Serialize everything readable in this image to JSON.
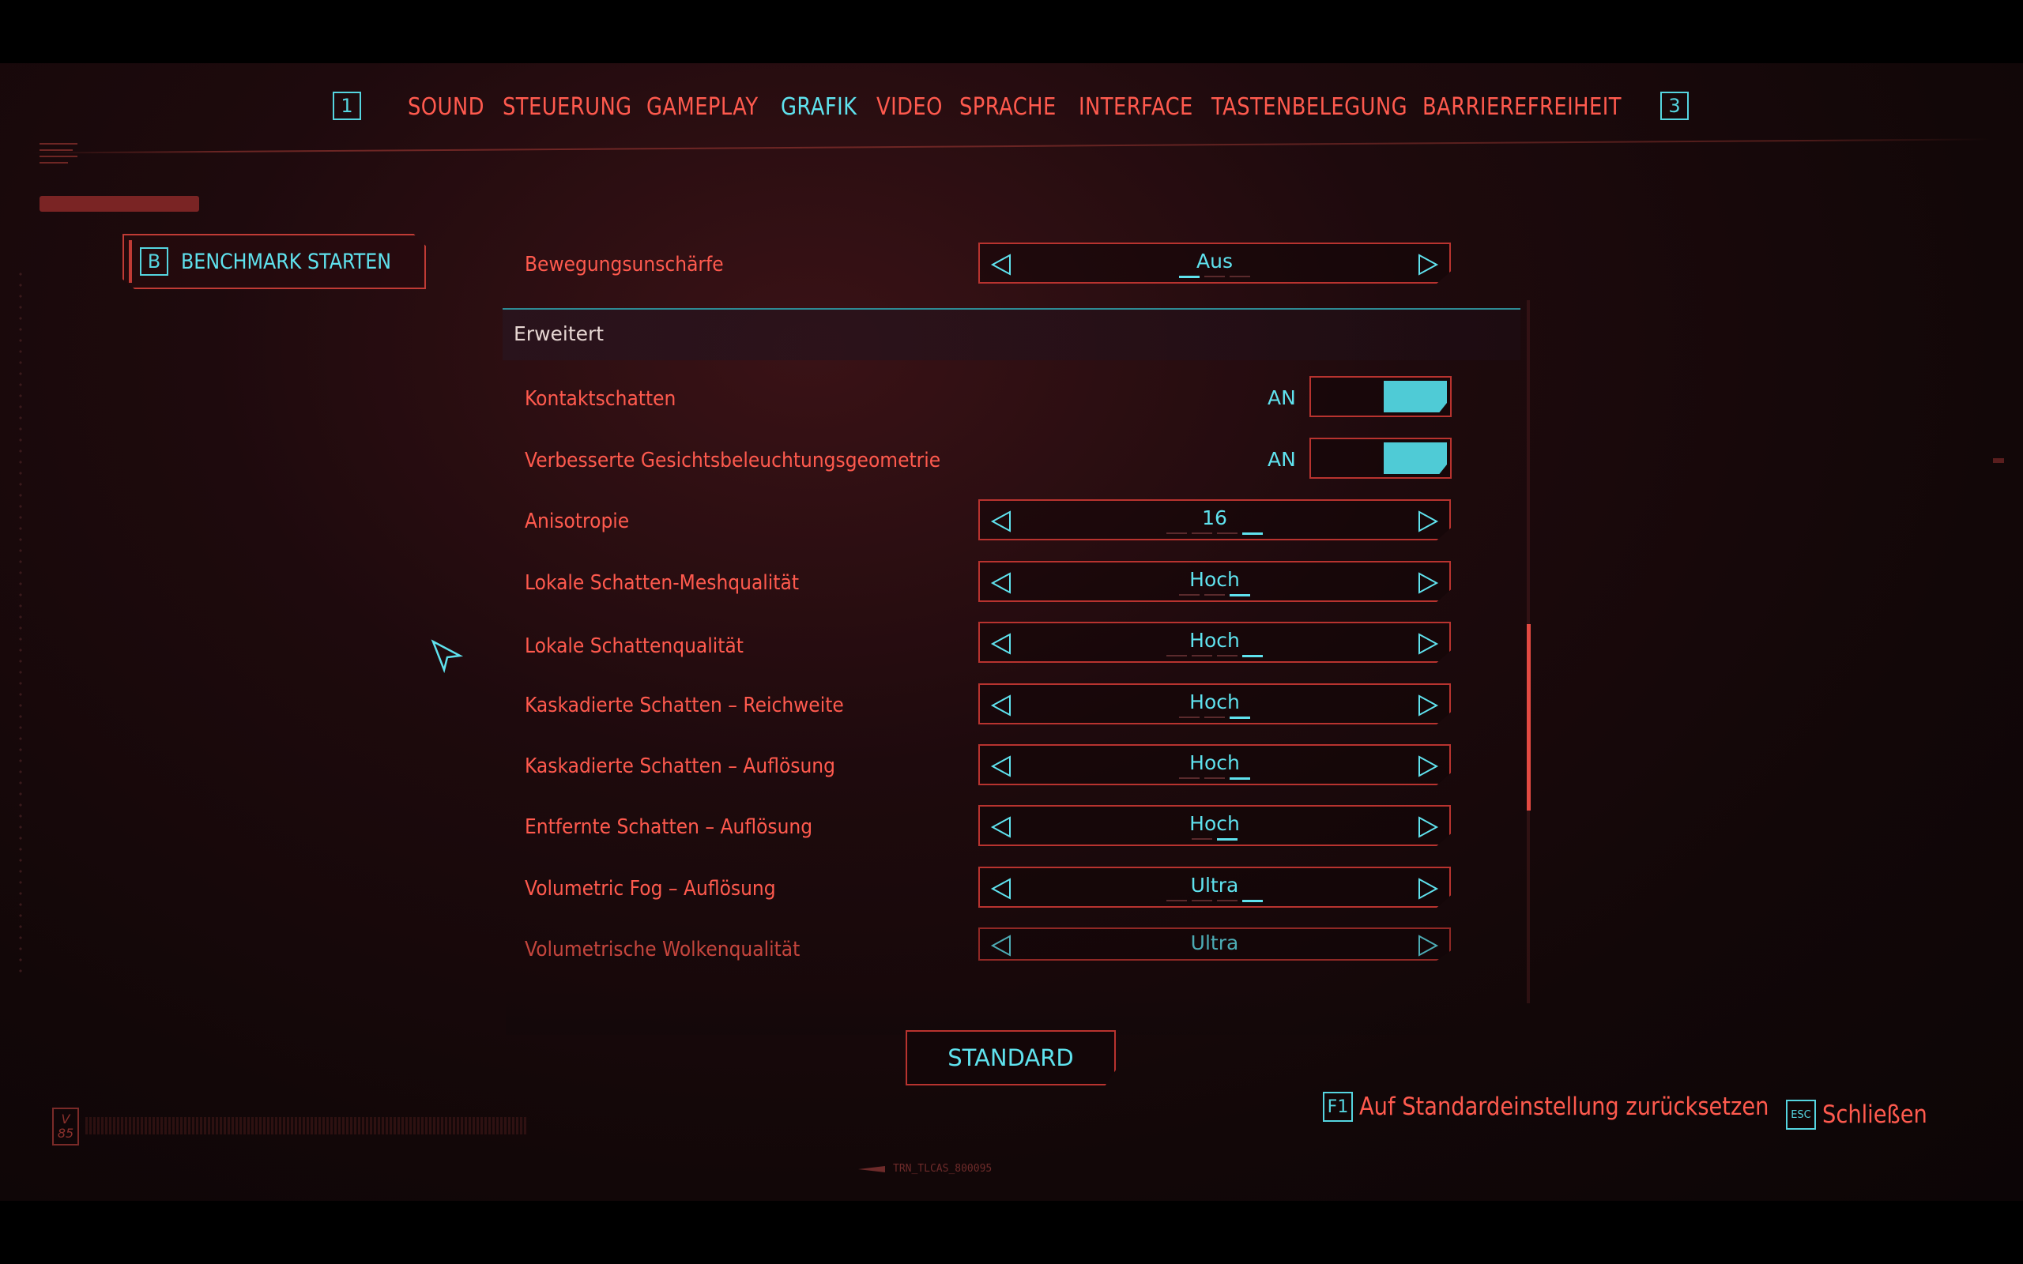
{
  "nav": {
    "left_key": "1",
    "right_key": "3",
    "tabs": [
      {
        "label": "SOUND",
        "active": false
      },
      {
        "label": "STEUERUNG",
        "active": false
      },
      {
        "label": "GAMEPLAY",
        "active": false
      },
      {
        "label": "GRAFIK",
        "active": true
      },
      {
        "label": "VIDEO",
        "active": false
      },
      {
        "label": "SPRACHE",
        "active": false
      },
      {
        "label": "INTERFACE",
        "active": false
      },
      {
        "label": "TASTENBELEGUNG",
        "active": false
      },
      {
        "label": "BARRIEREFREIHEIT",
        "active": false
      }
    ]
  },
  "benchmark": {
    "key": "B",
    "label": "BENCHMARK STARTEN"
  },
  "settings": {
    "motion_blur": {
      "label": "Bewegungsunschärfe",
      "value": "Aus"
    },
    "section_title": "Erweitert",
    "rows": [
      {
        "label": "Kontaktschatten",
        "type": "toggle",
        "value": "AN"
      },
      {
        "label": "Verbesserte Gesichtsbeleuchtungsgeometrie",
        "type": "toggle",
        "value": "AN"
      },
      {
        "label": "Anisotropie",
        "type": "selector",
        "value": "16"
      },
      {
        "label": "Lokale Schatten-Meshqualität",
        "type": "selector",
        "value": "Hoch"
      },
      {
        "label": "Lokale Schattenqualität",
        "type": "selector",
        "value": "Hoch"
      },
      {
        "label": "Kaskadierte Schatten – Reichweite",
        "type": "selector",
        "value": "Hoch"
      },
      {
        "label": "Kaskadierte Schatten – Auflösung",
        "type": "selector",
        "value": "Hoch"
      },
      {
        "label": "Entfernte Schatten – Auflösung",
        "type": "selector",
        "value": "Hoch"
      },
      {
        "label": "Volumetric Fog – Auflösung",
        "type": "selector",
        "value": "Ultra"
      },
      {
        "label": "Volumetrische Wolkenqualität",
        "type": "selector",
        "value": "Ultra"
      }
    ]
  },
  "bottom": {
    "standard_label": "STANDARD",
    "reset_key": "F1",
    "reset_label": "Auf Standardeinstellung zurücksetzen",
    "close_key": "ESC",
    "close_label": "Schließen",
    "footer_code": "TRN_TLCAS_800095"
  },
  "colors": {
    "accent_cyan": "#5fe2ee",
    "accent_red": "#ff5a4e",
    "border_red": "#b8332f",
    "background": "#1e0a0d"
  }
}
